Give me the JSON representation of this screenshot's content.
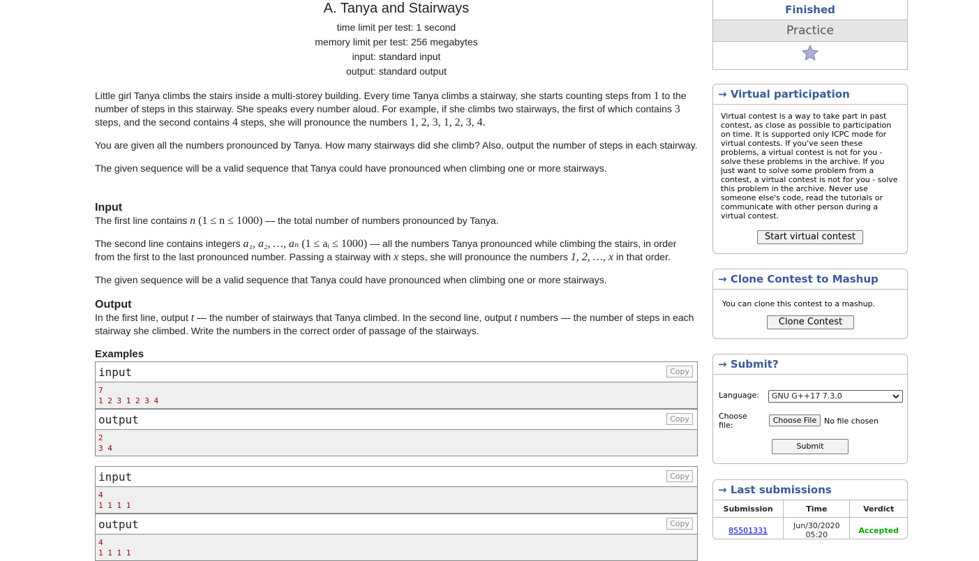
{
  "problem": {
    "title": "A. Tanya and Stairways",
    "time_limit": "time limit per test: 1 second",
    "memory_limit": "memory limit per test: 256 megabytes",
    "input": "input: standard input",
    "output": "output: standard output"
  },
  "statement": {
    "p1_a": "Little girl Tanya climbs the stairs inside a multi-storey building. Every time Tanya climbs a stairway, she starts counting steps from ",
    "p1_one": "1",
    "p1_b": " to the number of steps in this stairway. She speaks every number aloud. For example, if she climbs two stairways, the first of which contains ",
    "p1_three": "3",
    "p1_c": " steps, and the second contains ",
    "p1_four": "4",
    "p1_d": " steps, she will pronounce the numbers ",
    "p1_seq": "1, 2, 3, 1, 2, 3, 4",
    "p1_e": ".",
    "p2": "You are given all the numbers pronounced by Tanya. How many stairways did she climb? Also, output the number of steps in each stairway.",
    "p3": "The given sequence will be a valid sequence that Tanya could have pronounced when climbing one or more stairways."
  },
  "input_section": {
    "title": "Input",
    "l1_a": "The first line contains ",
    "l1_n": "n",
    "l1_cond": "(1 ≤ n ≤ 1000)",
    "l1_b": " — the total number of numbers pronounced by Tanya.",
    "l2_a": "The second line contains integers ",
    "l2_seq": "a₁, a₂, …, aₙ",
    "l2_cond": "(1 ≤ aᵢ ≤ 1000)",
    "l2_b": " — all the numbers Tanya pronounced while climbing the stairs, in order from the first to the last pronounced number. Passing a stairway with ",
    "l2_x": "x",
    "l2_c": " steps, she will pronounce the numbers ",
    "l2_seq2": "1, 2, …, x",
    "l2_d": " in that order.",
    "l3": "The given sequence will be a valid sequence that Tanya could have pronounced when climbing one or more stairways."
  },
  "output_section": {
    "title": "Output",
    "a": "In the first line, output ",
    "t1": "t",
    "b": " — the number of stairways that Tanya climbed. In the second line, output ",
    "t2": "t",
    "c": " numbers — the number of steps in each stairway she climbed. Write the numbers in the correct order of passage of the stairways."
  },
  "examples": {
    "title": "Examples",
    "input_label": "input",
    "output_label": "output",
    "copy_label": "Copy",
    "items": [
      {
        "input": "7\n1 2 3 1 2 3 4",
        "output": "2\n3 4"
      },
      {
        "input": "4\n1 1 1 1",
        "output": "4\n1 1 1 1"
      }
    ]
  },
  "sidebar": {
    "status_finished": "Finished",
    "status_practice": "Practice",
    "star_icon": "star-icon",
    "virtual": {
      "caption": "Virtual participation",
      "arrow": "→",
      "text": "Virtual contest is a way to take part in past contest, as close as possible to participation on time. It is supported only ICPC mode for virtual contests. If you've seen these problems, a virtual contest is not for you - solve these problems in the archive. If you just want to solve some problem from a contest, a virtual contest is not for you - solve this problem in the archive. Never use someone else's code, read the tutorials or communicate with other person during a virtual contest.",
      "button": "Start virtual contest"
    },
    "clone": {
      "caption": "Clone Contest to Mashup",
      "arrow": "→",
      "text": "You can clone this contest to a mashup.",
      "button": "Clone Contest"
    },
    "submit": {
      "caption": "Submit?",
      "arrow": "→",
      "language_label": "Language:",
      "language_value": "GNU G++17 7.3.0",
      "file_label": "Choose file:",
      "file_button": "Choose File",
      "file_status": "No file chosen",
      "submit_button": "Submit"
    },
    "last": {
      "caption": "Last submissions",
      "arrow": "→",
      "headers": [
        "Submission",
        "Time",
        "Verdict"
      ],
      "rows": [
        {
          "id": "85501331",
          "time_date": "Jun/30/2020",
          "time_clock": "05:20",
          "verdict": "Accepted"
        }
      ]
    }
  },
  "colors": {
    "accent": "#3b5998",
    "accepted": "#0a0",
    "sample_text": "#990000"
  }
}
